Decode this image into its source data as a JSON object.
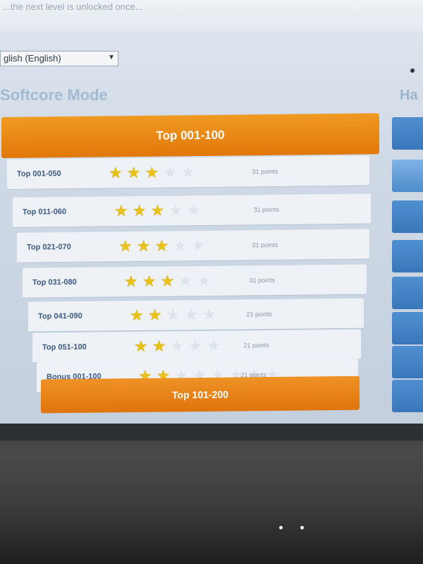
{
  "notice": "...the next level is unlocked once...",
  "language_select": {
    "value": "glish (English)"
  },
  "mode_title": "Softcore Mode",
  "right_column_title": "Ha",
  "header": "Top 001-100",
  "rows": [
    {
      "label": "Top 001-050",
      "stars_on": 3,
      "stars_total": 5,
      "score": "31 points"
    },
    {
      "label": "Top 011-060",
      "stars_on": 3,
      "stars_total": 5,
      "score": "31 points"
    },
    {
      "label": "Top 021-070",
      "stars_on": 3,
      "stars_total": 5,
      "score": "31 points"
    },
    {
      "label": "Top 031-080",
      "stars_on": 3,
      "stars_total": 5,
      "score": "31 points"
    },
    {
      "label": "Top 041-090",
      "stars_on": 2,
      "stars_total": 5,
      "score": "21 points"
    },
    {
      "label": "Top 051-100",
      "stars_on": 2,
      "stars_total": 5,
      "score": "21 points"
    },
    {
      "label": "Bonus 001-100",
      "stars_on": 2,
      "stars_total": 8,
      "score": "21 points"
    }
  ],
  "footer": "Top 101-200",
  "colors": {
    "accent": "#e8870f",
    "star": "#e8c21a",
    "link": "#3c5a86"
  }
}
